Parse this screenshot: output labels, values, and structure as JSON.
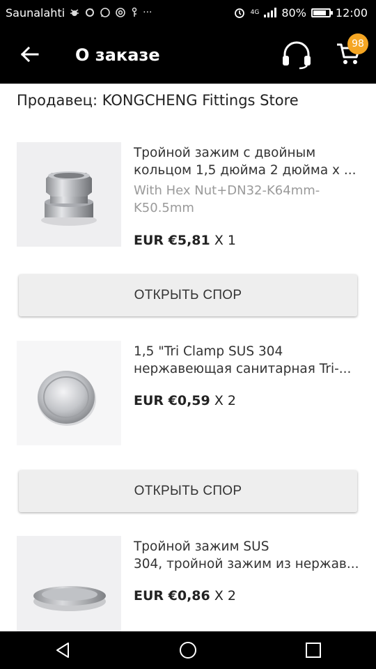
{
  "status_bar": {
    "carrier": "Saunalahti",
    "extra": "···",
    "network": "4G",
    "battery": "80%",
    "time": "12:00"
  },
  "header": {
    "title": "О заказе",
    "cart_count": "98"
  },
  "seller": {
    "label": "Продавец: KONGCHENG Fittings Store"
  },
  "items": [
    {
      "title_line1": "Тройной зажим с двойным",
      "title_line2": "кольцом 1,5 дюйма 2 дюйма х ...",
      "variant_line1": "With Hex Nut+DN32-K64mm-",
      "variant_line2": "K50.5mm",
      "price": "EUR €5,81",
      "qty": "X 1",
      "dispute_label": "ОТКРЫТЬ СПОР"
    },
    {
      "title_line1": "1,5 \"Tri Clamp SUS 304",
      "title_line2": "нержавеющая санитарная Tri-...",
      "price": "EUR €0,59",
      "qty": "X 2",
      "dispute_label": "ОТКРЫТЬ СПОР"
    },
    {
      "title_line1": "Тройной зажим SUS",
      "title_line2": "304, тройной зажим из нержав...",
      "price": "EUR €0,86",
      "qty": "X 2"
    }
  ],
  "colors": {
    "header_bg": "#000000",
    "badge": "#f5a623",
    "button_bg": "#eeeeee"
  }
}
